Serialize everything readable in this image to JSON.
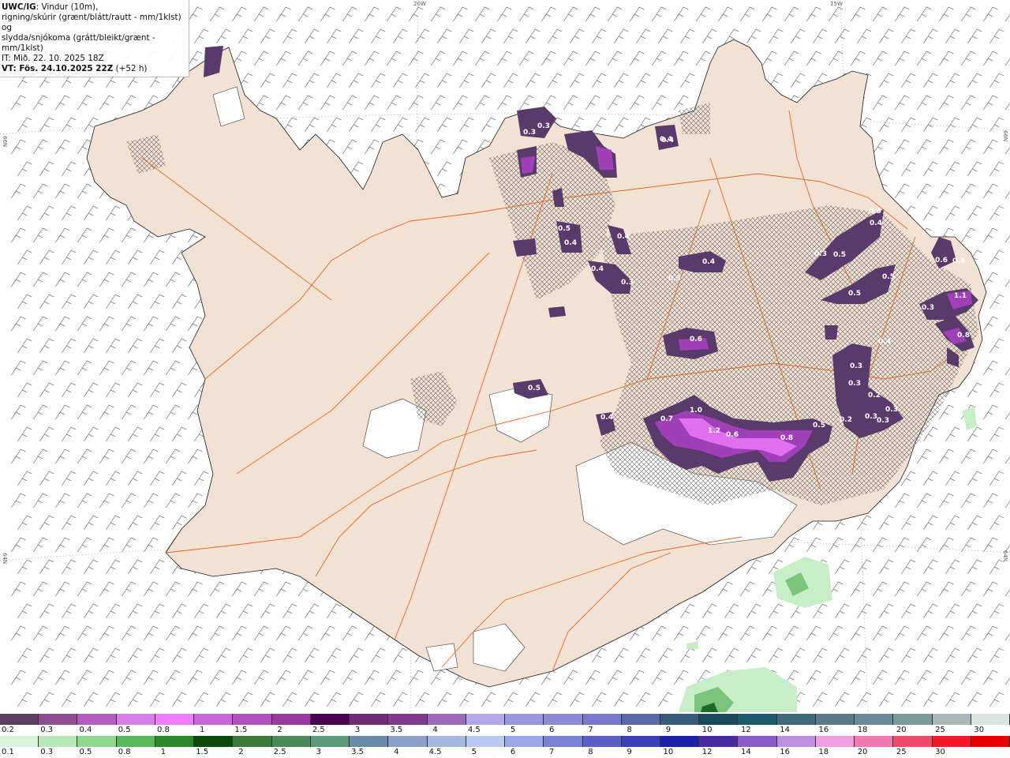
{
  "title": {
    "model": "UWC/IG",
    "line1": ": Vindur (10m),",
    "line2": "rigning/skúrir (grænt/blátt/rautt - mm/1klst) og",
    "line3": "slydda/snjókoma (grátt/bleikt/grænt - mm/1klst)",
    "line4": "IT: Mið. 22. 10. 2025 18Z",
    "line5_prefix": "VT: Fös. 24.10.2025 22Z",
    "line5_suffix": " (+52 h)"
  },
  "grid_labels": {
    "lon_20w": "20W",
    "lon_15w": "15W",
    "lat_left": "66N",
    "lat_right": "66N",
    "lat_left_low": "64N",
    "lat_right_low": "64N"
  },
  "colors": {
    "land": "#f2e2d3",
    "coast": "#1a1a1a",
    "roads": "#e8642a",
    "glacier": "#ffffff",
    "barbs": "#707070",
    "snow_dark": "#5a3a6a",
    "snow_mid": "#a040b8",
    "snow_light": "#e070f0",
    "rain_light": "#c8eec8",
    "rain_mid": "#7cc47c",
    "rain_dark": "#1a6a2a"
  },
  "precip_labels": [
    {
      "text": "0.3"
    },
    {
      "text": "0.4"
    },
    {
      "text": "0.3"
    },
    {
      "text": "0.4"
    },
    {
      "text": "0.5"
    },
    {
      "text": "0.4"
    },
    {
      "text": "0.4"
    },
    {
      "text": "0.3"
    },
    {
      "text": "0.4"
    },
    {
      "text": "0.3"
    },
    {
      "text": "0.4"
    },
    {
      "text": "0.6"
    },
    {
      "text": "0.5"
    },
    {
      "text": "0.4"
    },
    {
      "text": "1.0"
    },
    {
      "text": "0.7"
    },
    {
      "text": "1.2"
    },
    {
      "text": "0.6"
    },
    {
      "text": "0.8"
    },
    {
      "text": "0.5"
    },
    {
      "text": "0.5"
    },
    {
      "text": "0.4"
    },
    {
      "text": "0.3"
    },
    {
      "text": "0.5"
    },
    {
      "text": "0.5"
    },
    {
      "text": "0.5"
    },
    {
      "text": "0.3"
    },
    {
      "text": "0.3"
    },
    {
      "text": "0.2"
    },
    {
      "text": "0.3"
    },
    {
      "text": "0.2"
    },
    {
      "text": "0.3"
    },
    {
      "text": "0.6"
    },
    {
      "text": "0.4"
    },
    {
      "text": "1.1"
    },
    {
      "text": "0.8"
    },
    {
      "text": "0.3"
    },
    {
      "text": "0.4"
    },
    {
      "text": "0.3"
    }
  ],
  "legend_snow": {
    "labels": [
      "0.2",
      "0.3",
      "0.4",
      "0.5",
      "0.8",
      "1",
      "1.5",
      "2",
      "2.5",
      "3",
      "3.5",
      "4",
      "4.5",
      "5",
      "6",
      "7",
      "8",
      "9",
      "10",
      "12",
      "14",
      "16",
      "18",
      "20",
      "25",
      "30"
    ],
    "colors": [
      "#5a3f5e",
      "#8d4d8f",
      "#b35cc0",
      "#d77fe6",
      "#f07cff",
      "#c765d8",
      "#b24fc1",
      "#9a3a9e",
      "#4a0050",
      "#6d2d74",
      "#7f3a8c",
      "#9a6ab8",
      "#b4a8e8",
      "#9898e0",
      "#8a8ad4",
      "#7a7acc",
      "#5a6aa8",
      "#3a5a7a",
      "#1a4a5a",
      "#1f5a6a",
      "#3f6a7a",
      "#5a7a8a",
      "#6a8a9a",
      "#7a9a9a",
      "#a8b8b8",
      "#d8e4e4"
    ]
  },
  "legend_rain": {
    "labels": [
      "0.1",
      "0.3",
      "0.5",
      "0.8",
      "1",
      "1.5",
      "2",
      "2.5",
      "3",
      "3.5",
      "4",
      "4.5",
      "5",
      "6",
      "7",
      "8",
      "9",
      "10",
      "12",
      "14",
      "16",
      "18",
      "20",
      "25",
      "30"
    ],
    "colors": [
      "#d8f4d8",
      "#b8e8b8",
      "#90d890",
      "#5ab85a",
      "#2a8a2a",
      "#0a4a0a",
      "#3a7a3a",
      "#4a8a5a",
      "#5a9a7a",
      "#6a8aaa",
      "#8aa0c8",
      "#a4b8e0",
      "#b8c8f0",
      "#9aa8e8",
      "#7a80d8",
      "#5a60c8",
      "#3a40b8",
      "#1a20a8",
      "#4a2aa0",
      "#8a5ac8",
      "#c090e0",
      "#f0a0e0",
      "#f07ab0",
      "#f04a6a",
      "#f01a2a",
      "#e80000"
    ]
  }
}
